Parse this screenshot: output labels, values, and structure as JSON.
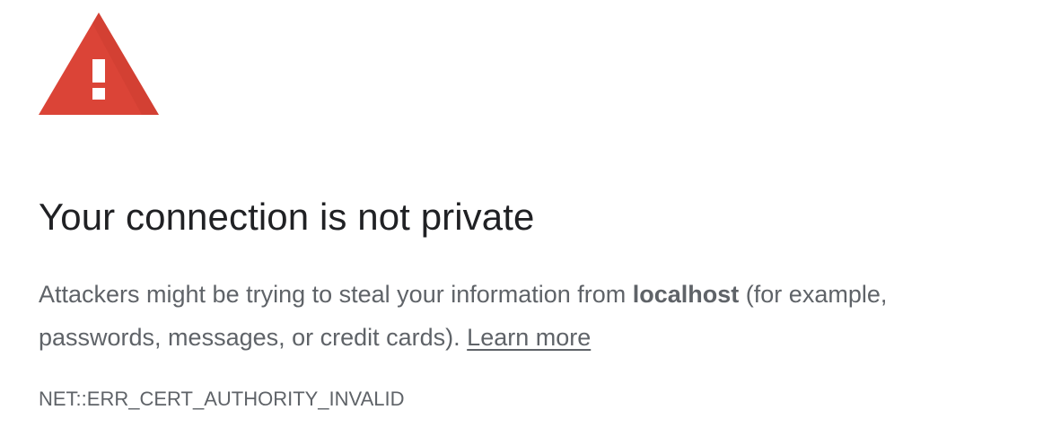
{
  "icon": {
    "name": "warning-triangle-icon",
    "color": "#db4437",
    "glyph": "!"
  },
  "heading": "Your connection is not private",
  "explanation": {
    "prefix": "Attackers might be trying to steal your information from ",
    "host": "localhost",
    "line1_suffix": " (for example,",
    "line2": "passwords, messages, or credit cards). ",
    "learn_more": "Learn more"
  },
  "error_code": "NET::ERR_CERT_AUTHORITY_INVALID",
  "colors": {
    "heading": "#202124",
    "body_text": "#5f6368"
  }
}
